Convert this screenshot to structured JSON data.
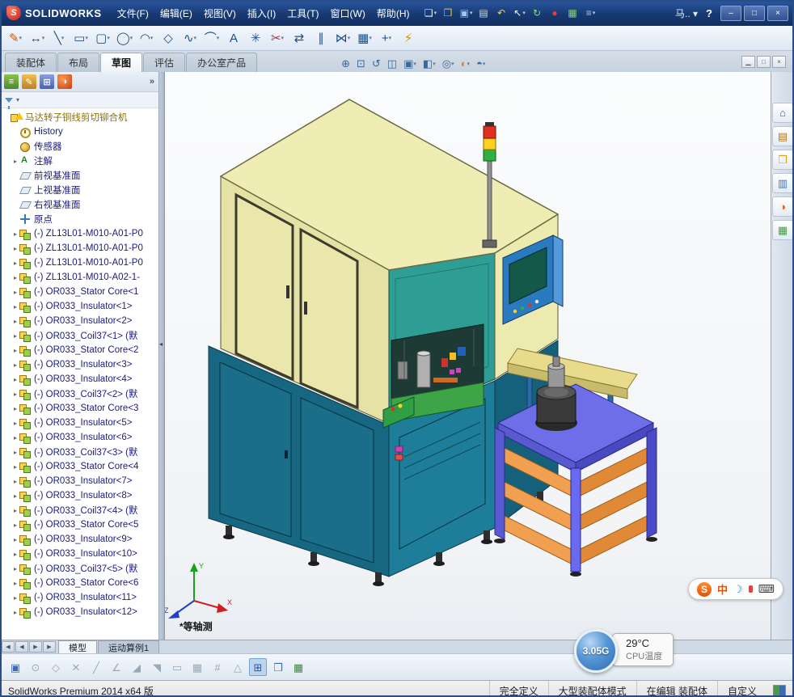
{
  "titlebar": {
    "brand": "SOLIDWORKS",
    "logo_letter": "S",
    "doc_short": "马.. ▾",
    "help": "?",
    "window": {
      "min": "–",
      "max": "□",
      "close": "×"
    },
    "menus": [
      {
        "name": "menu-file",
        "label": "文件(F)"
      },
      {
        "name": "menu-edit",
        "label": "编辑(E)"
      },
      {
        "name": "menu-view",
        "label": "视图(V)"
      },
      {
        "name": "menu-insert",
        "label": "插入(I)"
      },
      {
        "name": "menu-tools",
        "label": "工具(T)"
      },
      {
        "name": "menu-window",
        "label": "窗口(W)"
      },
      {
        "name": "menu-help",
        "label": "帮助(H)"
      }
    ],
    "tools": [
      {
        "name": "new-document-icon",
        "glyph": "❏",
        "style": "color:#e8eef8",
        "dd": "▾"
      },
      {
        "name": "open-document-icon",
        "glyph": "❒",
        "style": "color:#f0c040",
        "dd": ""
      },
      {
        "name": "save-icon",
        "glyph": "▣",
        "style": "color:#9ec8f0",
        "dd": "▾"
      },
      {
        "name": "print-icon",
        "glyph": "▤",
        "style": "color:#d0d8e0",
        "dd": ""
      },
      {
        "name": "undo-icon",
        "glyph": "↶",
        "style": "color:#f0d060",
        "dd": ""
      },
      {
        "name": "select-icon",
        "glyph": "↖",
        "style": "color:#ffffff",
        "dd": "▾"
      },
      {
        "name": "rebuild-icon",
        "glyph": "↻",
        "style": "color:#80e080",
        "dd": ""
      },
      {
        "name": "record-icon",
        "glyph": "●",
        "style": "color:#e04040",
        "dd": ""
      },
      {
        "name": "sheet-icon",
        "glyph": "▦",
        "style": "color:#80d080",
        "dd": ""
      },
      {
        "name": "list-icon",
        "glyph": "≡",
        "style": "color:#a8c8f0",
        "dd": "▾"
      }
    ]
  },
  "sketch_toolbar": {
    "items": [
      {
        "name": "sketch-icon",
        "glyph": "✎",
        "style": "color:#c05a10",
        "dd": "▾"
      },
      {
        "name": "smart-dimension-icon",
        "glyph": "↔",
        "style": "color:#1d4e89",
        "dd": "▾"
      },
      {
        "name": "line-icon",
        "glyph": "╲",
        "style": "color:#1d4e89",
        "dd": "▾"
      },
      {
        "name": "rectangle-icon",
        "glyph": "▭",
        "style": "color:#1d4e89",
        "dd": "▾"
      },
      {
        "name": "slot-icon",
        "glyph": "▢",
        "style": "color:#1d4e89",
        "dd": "▾"
      },
      {
        "name": "circle-icon",
        "glyph": "◯",
        "style": "color:#1d4e89",
        "dd": "▾"
      },
      {
        "name": "arc-icon",
        "glyph": "◠",
        "style": "color:#1d4e89",
        "dd": "▾"
      },
      {
        "name": "polygon-icon",
        "glyph": "◇",
        "style": "color:#1d4e89",
        "dd": ""
      },
      {
        "name": "spline-icon",
        "glyph": "∿",
        "style": "color:#1d4e89",
        "dd": "▾"
      },
      {
        "name": "fillet-icon",
        "glyph": "⌒",
        "style": "color:#1d4e89",
        "dd": "▾"
      },
      {
        "name": "text-icon",
        "glyph": "A",
        "style": "color:#1d4e89",
        "dd": ""
      },
      {
        "name": "point-icon",
        "glyph": "✳",
        "style": "color:#1d4e89",
        "dd": ""
      },
      {
        "name": "trim-icon",
        "glyph": "✂",
        "style": "color:#b03030",
        "dd": "▾"
      },
      {
        "name": "convert-entities-icon",
        "glyph": "⇄",
        "style": "color:#1d4e89",
        "dd": ""
      },
      {
        "name": "offset-icon",
        "glyph": "∥",
        "style": "color:#1d4e89",
        "dd": ""
      },
      {
        "name": "mirror-icon",
        "glyph": "⋈",
        "style": "color:#1d4e89",
        "dd": "▾"
      },
      {
        "name": "pattern-icon",
        "glyph": "▦",
        "style": "color:#1d4e89",
        "dd": "▾"
      },
      {
        "name": "move-icon",
        "glyph": "+",
        "style": "color:#1d4e89",
        "dd": "▾"
      },
      {
        "name": "instant3d-icon",
        "glyph": "⚡",
        "style": "color:#d09010",
        "dd": ""
      }
    ]
  },
  "ribbon_tabs": {
    "items": [
      {
        "name": "tab-assembly",
        "label": "装配体",
        "cls": "rtab"
      },
      {
        "name": "tab-layout",
        "label": "布局",
        "cls": "rtab"
      },
      {
        "name": "tab-sketch",
        "label": "草图",
        "cls": "rtab active"
      },
      {
        "name": "tab-evaluate",
        "label": "评估",
        "cls": "rtab"
      },
      {
        "name": "tab-office-products",
        "label": "办公室产品",
        "cls": "rtab"
      }
    ]
  },
  "headsup": {
    "items": [
      {
        "name": "zoom-fit-icon",
        "glyph": "⊕",
        "dd": ""
      },
      {
        "name": "zoom-area-icon",
        "glyph": "⊡",
        "dd": ""
      },
      {
        "name": "previous-view-icon",
        "glyph": "↺",
        "dd": ""
      },
      {
        "name": "section-view-icon",
        "glyph": "◫",
        "dd": ""
      },
      {
        "name": "view-orientation-icon",
        "glyph": "▣",
        "dd": "▾"
      },
      {
        "name": "display-style-icon",
        "glyph": "◧",
        "dd": "▾"
      },
      {
        "name": "hide-show-icon",
        "glyph": "◎",
        "dd": "▾"
      },
      {
        "name": "edit-appearance-icon",
        "glyph": "◐",
        "style": "color:#e08030",
        "dd": "▾"
      },
      {
        "name": "apply-scene-icon",
        "glyph": "◓",
        "dd": "▾"
      }
    ]
  },
  "docwin": {
    "items": [
      {
        "name": "doc-minimize-icon",
        "glyph": "▁"
      },
      {
        "name": "doc-restore-icon",
        "glyph": "□"
      },
      {
        "name": "doc-close-icon",
        "glyph": "×"
      }
    ]
  },
  "feature_tree": {
    "overflow": "»",
    "items": [
      {
        "arrow": "",
        "icon": "tico ico-asmwarn",
        "icon_name": "assembly-warning-icon",
        "label": "马达转子铜线剪切铆合机"
      },
      {
        "arrow": "",
        "icon": "tico ico-history",
        "icon_name": "history-icon",
        "label": "History"
      },
      {
        "arrow": "",
        "icon": "tico ico-sensor",
        "icon_name": "sensor-icon",
        "label": "传感器"
      },
      {
        "arrow": "▸",
        "icon": "tico ico-anno",
        "icon_name": "annotations-icon",
        "label": "注解"
      },
      {
        "arrow": "",
        "icon": "tico ico-plane",
        "icon_name": "plane-icon",
        "label": "前视基准面"
      },
      {
        "arrow": "",
        "icon": "tico ico-plane",
        "icon_name": "plane-icon",
        "label": "上视基准面"
      },
      {
        "arrow": "",
        "icon": "tico ico-plane",
        "icon_name": "plane-icon",
        "label": "右视基准面"
      },
      {
        "arrow": "",
        "icon": "tico ico-origin",
        "icon_name": "origin-icon",
        "label": "原点"
      },
      {
        "arrow": "▸",
        "icon": "tico ico-asm",
        "icon_name": "assembly-icon",
        "label": "(-) ZL13L01-M010-A01-P0"
      },
      {
        "arrow": "▸",
        "icon": "tico ico-asm",
        "icon_name": "assembly-icon",
        "label": "(-) ZL13L01-M010-A01-P0"
      },
      {
        "arrow": "▸",
        "icon": "tico ico-asm",
        "icon_name": "assembly-icon",
        "label": "(-) ZL13L01-M010-A01-P0"
      },
      {
        "arrow": "▸",
        "icon": "tico ico-asm",
        "icon_name": "assembly-icon",
        "label": "(-) ZL13L01-M010-A02-1-"
      },
      {
        "arrow": "▸",
        "icon": "tico ico-asm",
        "icon_name": "part-icon",
        "label": "(-) OR033_Stator Core<1"
      },
      {
        "arrow": "▸",
        "icon": "tico ico-asm",
        "icon_name": "part-icon",
        "label": "(-) OR033_Insulator<1>"
      },
      {
        "arrow": "▸",
        "icon": "tico ico-asm",
        "icon_name": "part-icon",
        "label": "(-) OR033_Insulator<2>"
      },
      {
        "arrow": "▸",
        "icon": "tico ico-asm",
        "icon_name": "part-icon",
        "label": "(-) OR033_Coil37<1> (默"
      },
      {
        "arrow": "▸",
        "icon": "tico ico-asm",
        "icon_name": "part-icon",
        "label": "(-) OR033_Stator Core<2"
      },
      {
        "arrow": "▸",
        "icon": "tico ico-asm",
        "icon_name": "part-icon",
        "label": "(-) OR033_Insulator<3>"
      },
      {
        "arrow": "▸",
        "icon": "tico ico-asm",
        "icon_name": "part-icon",
        "label": "(-) OR033_Insulator<4>"
      },
      {
        "arrow": "▸",
        "icon": "tico ico-asm",
        "icon_name": "part-icon",
        "label": "(-) OR033_Coil37<2> (默"
      },
      {
        "arrow": "▸",
        "icon": "tico ico-asm",
        "icon_name": "part-icon",
        "label": "(-) OR033_Stator Core<3"
      },
      {
        "arrow": "▸",
        "icon": "tico ico-asm",
        "icon_name": "part-icon",
        "label": "(-) OR033_Insulator<5>"
      },
      {
        "arrow": "▸",
        "icon": "tico ico-asm",
        "icon_name": "part-icon",
        "label": "(-) OR033_Insulator<6>"
      },
      {
        "arrow": "▸",
        "icon": "tico ico-asm",
        "icon_name": "part-icon",
        "label": "(-) OR033_Coil37<3> (默"
      },
      {
        "arrow": "▸",
        "icon": "tico ico-asm",
        "icon_name": "part-icon",
        "label": "(-) OR033_Stator Core<4"
      },
      {
        "arrow": "▸",
        "icon": "tico ico-asm",
        "icon_name": "part-icon",
        "label": "(-) OR033_Insulator<7>"
      },
      {
        "arrow": "▸",
        "icon": "tico ico-asm",
        "icon_name": "part-icon",
        "label": "(-) OR033_Insulator<8>"
      },
      {
        "arrow": "▸",
        "icon": "tico ico-asm",
        "icon_name": "part-icon",
        "label": "(-) OR033_Coil37<4> (默"
      },
      {
        "arrow": "▸",
        "icon": "tico ico-asm",
        "icon_name": "part-icon",
        "label": "(-) OR033_Stator Core<5"
      },
      {
        "arrow": "▸",
        "icon": "tico ico-asm",
        "icon_name": "part-icon",
        "label": "(-) OR033_Insulator<9>"
      },
      {
        "arrow": "▸",
        "icon": "tico ico-asm",
        "icon_name": "part-icon",
        "label": "(-) OR033_Insulator<10>"
      },
      {
        "arrow": "▸",
        "icon": "tico ico-asm",
        "icon_name": "part-icon",
        "label": "(-) OR033_Coil37<5> (默"
      },
      {
        "arrow": "▸",
        "icon": "tico ico-asm",
        "icon_name": "part-icon",
        "label": "(-) OR033_Stator Core<6"
      },
      {
        "arrow": "▸",
        "icon": "tico ico-asm",
        "icon_name": "part-icon",
        "label": "(-) OR033_Insulator<11>"
      },
      {
        "arrow": "▸",
        "icon": "tico ico-asm",
        "icon_name": "part-icon",
        "label": "(-) OR033_Insulator<12>"
      }
    ]
  },
  "taskpane": {
    "items": [
      {
        "name": "taskpane-resources-icon",
        "glyph": "⌂",
        "style": "color:#2a5fa8"
      },
      {
        "name": "taskpane-design-library-icon",
        "glyph": "▤",
        "style": "color:#b07828"
      },
      {
        "name": "taskpane-file-explorer-icon",
        "glyph": "❒",
        "style": "color:#d8a020"
      },
      {
        "name": "taskpane-view-palette-icon",
        "glyph": "▥",
        "style": "color:#3a78b8"
      },
      {
        "name": "taskpane-appearances-icon",
        "glyph": "◑",
        "style": "color:#d86820"
      },
      {
        "name": "taskpane-custom-properties-icon",
        "glyph": "▦",
        "style": "color:#4a9a4a"
      }
    ]
  },
  "viewport": {
    "view_label": "*等轴测",
    "triad": {
      "x": "X",
      "y": "Y",
      "z": "Z"
    }
  },
  "model": {
    "palette": {
      "roof": "#EFECB4",
      "wall": "#E6E2A6",
      "wall_right": "#EDEAB0",
      "bevel_teal": "#2E9E95",
      "base_front": "#176682",
      "base_bevel": "#1E7E99",
      "base_right": "#15607A",
      "mechanism_green": "#3DA548",
      "cart_top": "#6E6EE8",
      "cart_side": "#5A5AD0",
      "tray_left": "#F0A050",
      "tray_right": "#E08A38",
      "conveyor_top": "#E8DC8C",
      "conveyor_side": "#C8BC6C",
      "signal_red": "#E03020",
      "signal_yellow": "#FFD020",
      "signal_green": "#30B040",
      "panel_blue": "#2A7AC0",
      "panel_screen": "#14584A"
    }
  },
  "bottom_tabs": {
    "nav": [
      {
        "name": "tab-scroll-first",
        "glyph": "◀"
      },
      {
        "name": "tab-scroll-prev",
        "glyph": "◀"
      },
      {
        "name": "tab-scroll-next",
        "glyph": "▶"
      },
      {
        "name": "tab-scroll-last",
        "glyph": "▶"
      }
    ],
    "items": [
      {
        "name": "tab-model",
        "label": "模型",
        "cls": "btab active"
      },
      {
        "name": "tab-motion-study",
        "label": "运动算例1",
        "cls": "btab"
      }
    ]
  },
  "bottom_toolbar": {
    "items": [
      {
        "name": "sketch-settings-icon",
        "glyph": "▣",
        "cls": "bt",
        "style": "color:#3a6ab0"
      },
      {
        "name": "circle-snap-icon",
        "glyph": "⊙",
        "cls": "bt dim"
      },
      {
        "name": "polygon-snap-icon",
        "glyph": "◇",
        "cls": "bt dim"
      },
      {
        "name": "intersect-snap-icon",
        "glyph": "✕",
        "cls": "bt dim"
      },
      {
        "name": "line-snap-icon",
        "glyph": "╱",
        "cls": "bt dim"
      },
      {
        "name": "angle-snap-icon",
        "glyph": "∠",
        "cls": "bt dim"
      },
      {
        "name": "tangent-snap-icon",
        "glyph": "◢",
        "cls": "bt dim"
      },
      {
        "name": "perpendicular-snap-icon",
        "glyph": "◥",
        "cls": "bt dim"
      },
      {
        "name": "rect-snap-icon",
        "glyph": "▭",
        "cls": "bt dim"
      },
      {
        "name": "grid-snap-icon",
        "glyph": "▦",
        "cls": "bt dim"
      },
      {
        "name": "hatch-icon",
        "glyph": "#",
        "cls": "bt dim"
      },
      {
        "name": "triangle-snap-icon",
        "glyph": "△",
        "cls": "bt dim"
      },
      {
        "name": "zoom-fit-small-icon",
        "glyph": "⊞",
        "cls": "bt pressed",
        "style": "color:#2a5a9a"
      },
      {
        "name": "viewport-layout-icon",
        "glyph": "❒",
        "cls": "bt",
        "style": "color:#3a6ab0"
      },
      {
        "name": "table-icon",
        "glyph": "▦",
        "cls": "bt",
        "style": "color:#3a8a3a"
      }
    ]
  },
  "statusbar": {
    "left": "SolidWorks Premium 2014 x64 版",
    "defined": "完全定义",
    "mode": "大型装配体模式",
    "editing": "在编辑 装配体",
    "custom": "自定义"
  },
  "overlays": {
    "cpu": {
      "value": "3.05G",
      "temp": "29°C",
      "label": "CPU温度"
    },
    "ime": {
      "logo": "S",
      "lang": "中",
      "moon": "☽",
      "kbd": "⌨"
    }
  }
}
